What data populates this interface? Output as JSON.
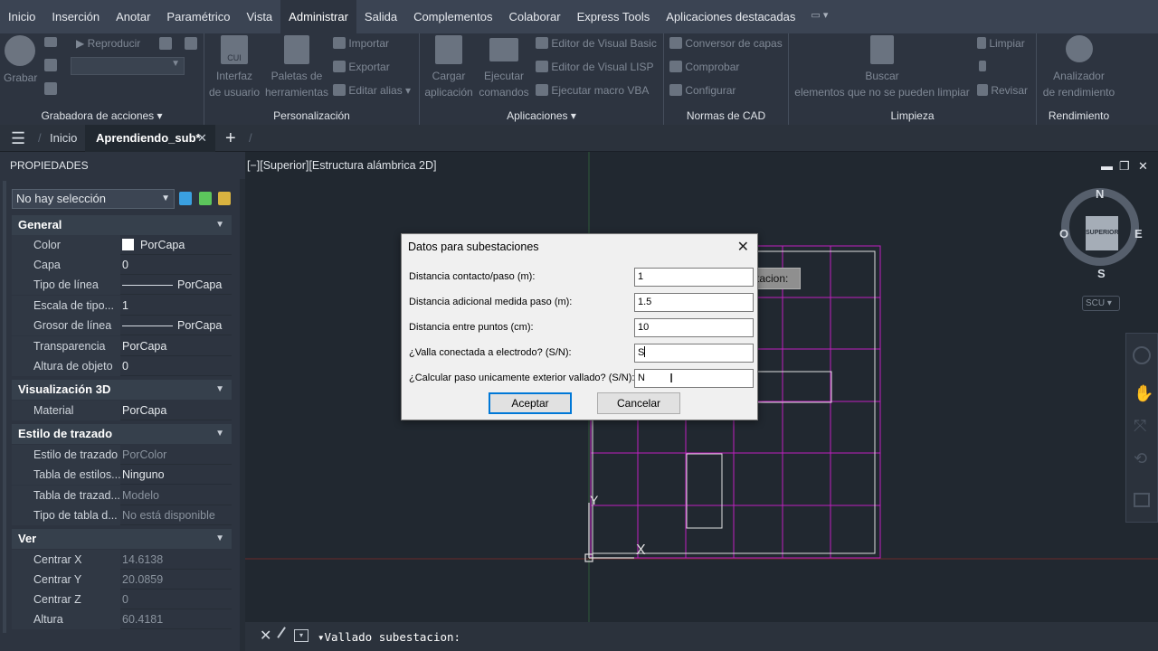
{
  "menu": {
    "tabs": [
      "Inicio",
      "Inserción",
      "Anotar",
      "Paramétrico",
      "Vista",
      "Administrar",
      "Salida",
      "Complementos",
      "Colaborar",
      "Express Tools",
      "Aplicaciones destacadas"
    ],
    "active": "Administrar"
  },
  "ribbon": {
    "grabadora": {
      "title": "Grabadora de acciones ▾",
      "grabar": "Grabar",
      "reproducir": "Reproducir"
    },
    "personalizacion": {
      "title": "Personalización",
      "interfaz1": "Interfaz",
      "interfaz2": "de usuario",
      "paletas1": "Paletas de",
      "paletas2": "herramientas",
      "importar": "Importar",
      "exportar": "Exportar",
      "editar_alias": "Editar alias ▾",
      "cui": "CUI"
    },
    "aplicaciones": {
      "title": "Aplicaciones ▾",
      "cargar1": "Cargar",
      "cargar2": "aplicación",
      "ejecutar1": "Ejecutar",
      "ejecutar2": "comandos",
      "vb": "Editor de Visual Basic",
      "lisp": "Editor de Visual LISP",
      "macro": "Ejecutar macro VBA"
    },
    "normas": {
      "title": "Normas de CAD",
      "conversor": "Conversor de capas",
      "comprobar": "Comprobar",
      "configurar": "Configurar"
    },
    "limpieza": {
      "title": "Limpieza",
      "buscar1": "Buscar",
      "buscar2": "elementos que no se pueden limpiar",
      "limpiar": "Limpiar",
      "revisar": "Revisar"
    },
    "rendimiento": {
      "title": "Rendimiento",
      "analizador1": "Analizador",
      "analizador2": "de rendimiento"
    }
  },
  "doctabs": {
    "inicio": "Inicio",
    "doc": "Aprendiendo_sub*",
    "add": "+"
  },
  "properties": {
    "title": "PROPIEDADES",
    "selection": "No hay selección",
    "general": {
      "title": "General",
      "rows": [
        {
          "label": "Color",
          "value": "PorCapa"
        },
        {
          "label": "Capa",
          "value": "0"
        },
        {
          "label": "Tipo de línea",
          "value": "PorCapa"
        },
        {
          "label": "Escala de tipo...",
          "value": "1"
        },
        {
          "label": "Grosor de línea",
          "value": "PorCapa"
        },
        {
          "label": "Transparencia",
          "value": "PorCapa"
        },
        {
          "label": "Altura de objeto",
          "value": "0"
        }
      ]
    },
    "vis3d": {
      "title": "Visualización 3D",
      "rows": [
        {
          "label": "Material",
          "value": "PorCapa"
        }
      ]
    },
    "trazado": {
      "title": "Estilo de trazado",
      "rows": [
        {
          "label": "Estilo de trazado",
          "value": "PorColor"
        },
        {
          "label": "Tabla de estilos...",
          "value": "Ninguno"
        },
        {
          "label": "Tabla de trazad...",
          "value": "Modelo"
        },
        {
          "label": "Tipo de tabla d...",
          "value": "No está disponible"
        }
      ]
    },
    "ver": {
      "title": "Ver",
      "rows": [
        {
          "label": "Centrar X",
          "value": "14.6138"
        },
        {
          "label": "Centrar Y",
          "value": "20.0859"
        },
        {
          "label": "Centrar Z",
          "value": "0"
        },
        {
          "label": "Altura",
          "value": "60.4181"
        }
      ]
    }
  },
  "viewport": {
    "label": "[−][Superior][Estructura alámbrica 2D]",
    "viewcube": {
      "n": "N",
      "s": "S",
      "e": "E",
      "o": "O",
      "face": "SUPERIOR",
      "ucs": "SCU ▾"
    },
    "partial_text": "tacion:",
    "axis_y": "Y",
    "axis_x": "X"
  },
  "command": {
    "text": "Vallado subestacion:"
  },
  "dialog": {
    "title": "Datos para subestaciones",
    "fields": [
      {
        "label": "Distancia contacto/paso (m):",
        "value": "1"
      },
      {
        "label": "Distancia adicional medida paso (m):",
        "value": "1.5"
      },
      {
        "label": "Distancia entre puntos (cm):",
        "value": "10"
      },
      {
        "label": "¿Valla conectada a electrodo? (S/N):",
        "value": "S"
      },
      {
        "label": "¿Calcular paso unicamente exterior vallado? (S/N):",
        "value": "N"
      }
    ],
    "ok": "Aceptar",
    "cancel": "Cancelar"
  },
  "colors": {
    "grid": "#c020c0",
    "background": "#212830",
    "dialog": "#f0f0f0",
    "accent": "#0078d7"
  }
}
